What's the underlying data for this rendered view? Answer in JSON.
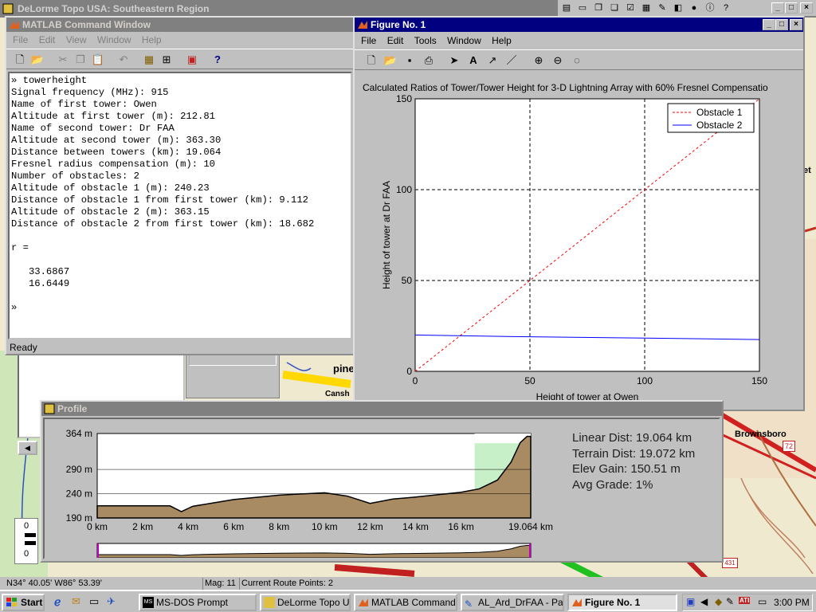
{
  "desktop": {
    "background_window_title": "DeLorme Topo USA: Southeastern Region",
    "map_labels": {
      "pine": "pine",
      "cansh": "Cansh",
      "brownsboro": "Brownsboro",
      "route72": "72",
      "route431": "431",
      "et": "et"
    },
    "status": {
      "coords": "N34° 40.05'  W86° 53.39'",
      "mag": "Mag: 11",
      "route_points": "Current Route Points: 2"
    },
    "left_gauge": {
      "top": "0",
      "bottom": "0"
    }
  },
  "matlab": {
    "title": "MATLAB Command Window",
    "menu": [
      "File",
      "Edit",
      "View",
      "Window",
      "Help"
    ],
    "console": [
      "» towerheight",
      "Signal frequency (MHz): 915",
      "Name of first tower: Owen",
      "Altitude at first tower (m): 212.81",
      "Name of second tower: Dr FAA",
      "Altitude at second tower (m): 363.30",
      "Distance between towers (km): 19.064",
      "Fresnel radius compensation (m): 10",
      "Number of obstacles: 2",
      "Altitude of obstacle 1 (m): 240.23",
      "Distance of obstacle 1 from first tower (km): 9.112",
      "Altitude of obstacle 2 (m): 363.15",
      "Distance of obstacle 2 from first tower (km): 18.682",
      "",
      "r =",
      "",
      "   33.6867",
      "   16.6449",
      "",
      "»"
    ],
    "status": "Ready"
  },
  "figure": {
    "title": "Figure No. 1",
    "menu": [
      "File",
      "Edit",
      "Tools",
      "Window",
      "Help"
    ]
  },
  "chart_data": [
    {
      "type": "line",
      "title": "Calculated Ratios of Tower/Tower Height for 3-D Lightning Array with 60% Fresnel Compensatio",
      "xlabel": "Height of tower at Owen",
      "ylabel": "Height of tower at Dr FAA",
      "xlim": [
        0,
        150
      ],
      "ylim": [
        0,
        150
      ],
      "xticks": [
        0,
        50,
        100,
        150
      ],
      "yticks": [
        0,
        50,
        100,
        150
      ],
      "grid": true,
      "legend_position": "top-right",
      "series": [
        {
          "name": "Obstacle 1",
          "color": "#ff0000",
          "style": "dashed",
          "x": [
            0,
            150
          ],
          "y": [
            0,
            150
          ]
        },
        {
          "name": "Obstacle 2",
          "color": "#0000ff",
          "style": "solid",
          "x": [
            0,
            50,
            100,
            150
          ],
          "y": [
            20,
            19,
            18.3,
            17.5
          ]
        }
      ]
    },
    {
      "type": "area",
      "title": "Profile",
      "y_ticks": [
        "364 m",
        "290 m",
        "240 m",
        "190 m"
      ],
      "y_tick_values": [
        364,
        290,
        240,
        190
      ],
      "x_ticks": [
        "0 km",
        "2 km",
        "4 km",
        "6 km",
        "8 km",
        "10 km",
        "12 km",
        "14 km",
        "16 km",
        "19.064 km"
      ],
      "x_tick_values": [
        0,
        2,
        4,
        6,
        8,
        10,
        12,
        14,
        16,
        19.064
      ],
      "xlim": [
        0,
        19.064
      ],
      "ylim": [
        190,
        364
      ],
      "x": [
        0,
        3.2,
        3.7,
        4.2,
        6,
        8,
        10,
        11,
        12,
        13,
        14,
        15,
        16,
        16.8,
        17.6,
        18.2,
        18.6,
        18.9,
        19.064
      ],
      "y": [
        215,
        215,
        203,
        214,
        228,
        237,
        242,
        235,
        220,
        229,
        233,
        238,
        243,
        250,
        268,
        305,
        345,
        358,
        358
      ],
      "stats": [
        "Linear Dist: 19.064 km",
        "Terrain Dist: 19.072 km",
        "Elev Gain: 150.51 m",
        "Avg Grade: 1%"
      ],
      "colors": {
        "terrain": "#a88b62",
        "cleared": "#c8f0c8",
        "sky": "#ffffff"
      }
    }
  ],
  "taskbar": {
    "start": "Start",
    "buttons": [
      "MS-DOS Prompt",
      "DeLorme Topo USA...",
      "MATLAB Command ...",
      "AL_Ard_DrFAA - Paint",
      "Figure No. 1"
    ],
    "clock": "3:00 PM"
  }
}
